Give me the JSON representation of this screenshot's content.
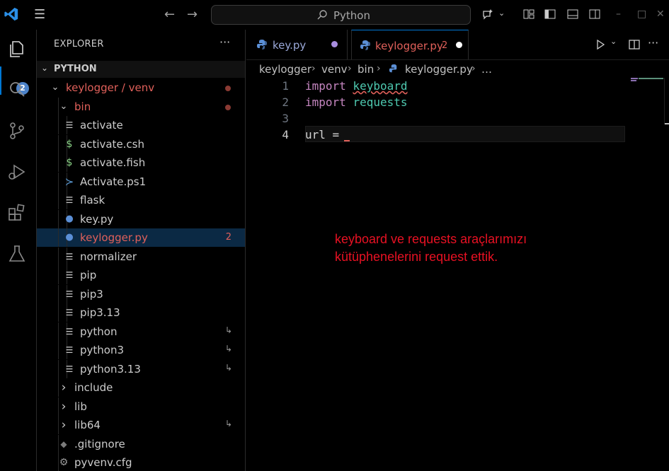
{
  "titlebar": {
    "search_text": "Python",
    "icons": [
      "vscode-logo-icon",
      "menu-icon",
      "back-arrow-icon",
      "forward-arrow-icon",
      "search-icon",
      "copilot-icon",
      "layout-icon",
      "toggle-sidebar-icon",
      "toggle-panel-icon",
      "toggle-secondary-sidebar-icon",
      "minimize-icon",
      "maximize-icon",
      "close-icon"
    ]
  },
  "activitybar": {
    "explorer_badge": "2",
    "items": [
      "explorer-icon",
      "search-icon",
      "source-control-icon",
      "run-debug-icon",
      "extensions-icon",
      "testing-icon"
    ]
  },
  "sidebar": {
    "title": "EXPLORER",
    "more": "···",
    "section": "PYTHON",
    "tree": [
      {
        "name": "keylogger / venv",
        "kind": "folder-open",
        "modified": true
      },
      {
        "name": "bin",
        "kind": "folder-open",
        "modified": true
      },
      {
        "name": "activate",
        "kind": "lines"
      },
      {
        "name": "activate.csh",
        "kind": "dollar"
      },
      {
        "name": "activate.fish",
        "kind": "dollar"
      },
      {
        "name": "Activate.ps1",
        "kind": "powershell"
      },
      {
        "name": "flask",
        "kind": "lines"
      },
      {
        "name": "key.py",
        "kind": "python"
      },
      {
        "name": "keylogger.py",
        "kind": "python",
        "count": "2"
      },
      {
        "name": "normalizer",
        "kind": "lines"
      },
      {
        "name": "pip",
        "kind": "lines"
      },
      {
        "name": "pip3",
        "kind": "lines"
      },
      {
        "name": "pip3.13",
        "kind": "lines"
      },
      {
        "name": "python",
        "kind": "lines",
        "symlink": "↳"
      },
      {
        "name": "python3",
        "kind": "lines",
        "symlink": "↳"
      },
      {
        "name": "python3.13",
        "kind": "lines",
        "symlink": "↳"
      },
      {
        "name": "include",
        "kind": "folder"
      },
      {
        "name": "lib",
        "kind": "folder"
      },
      {
        "name": "lib64",
        "kind": "folder",
        "symlink": "↳"
      },
      {
        "name": ".gitignore",
        "kind": "git"
      },
      {
        "name": "pyvenv.cfg",
        "kind": "gear"
      }
    ]
  },
  "tabs": [
    {
      "label": "key.py",
      "dirty": true
    },
    {
      "label": "keylogger.py",
      "count": "2",
      "dirty": true
    }
  ],
  "breadcrumb": [
    "keylogger",
    "venv",
    "bin",
    "keylogger.py",
    "…"
  ],
  "editor": {
    "line_numbers": [
      "1",
      "2",
      "3",
      "4"
    ],
    "lines": [
      {
        "kw": "import",
        "mod": "keyboard"
      },
      {
        "kw": "import",
        "mod": "requests"
      },
      {
        "text": ""
      },
      {
        "text": "url = "
      }
    ]
  },
  "annotation": {
    "line1": "keyboard ve requests araçlarımızı",
    "line2": "kütüphenelerini request ettik."
  },
  "colors": {
    "accent": "#0078d4",
    "modified": "#e0605a",
    "annotation": "#e81123",
    "keyword": "#c586c0",
    "module": "#4ec9b0"
  }
}
